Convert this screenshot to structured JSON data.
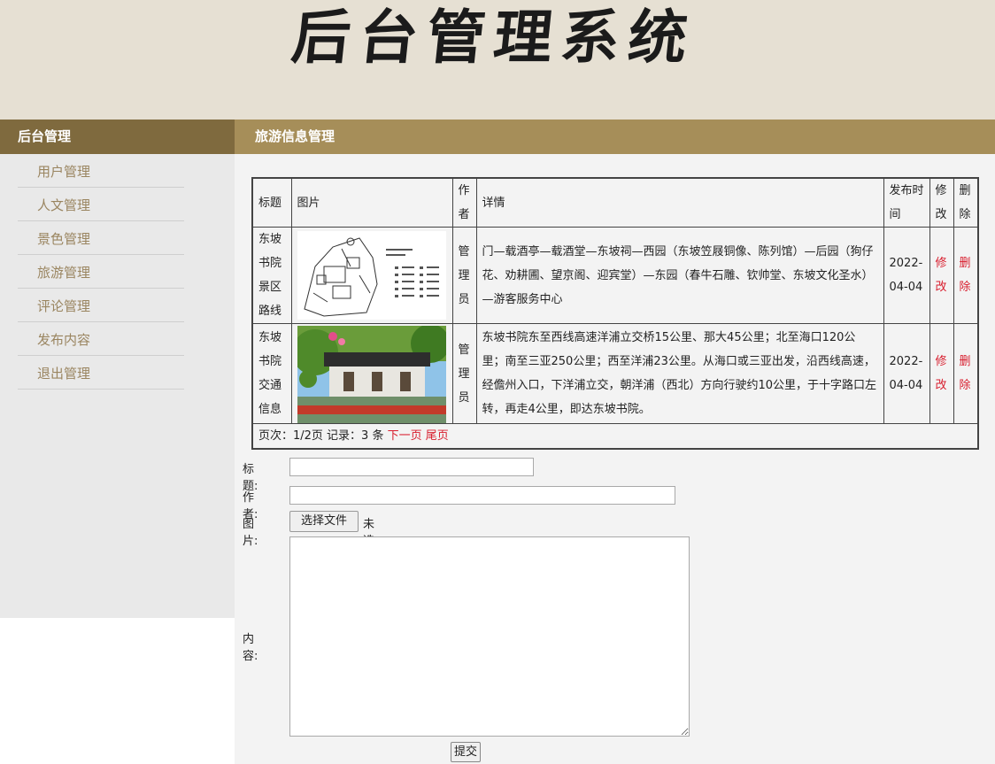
{
  "header": {
    "title": "后台管理系统"
  },
  "sidebar": {
    "heading": "后台管理",
    "items": [
      {
        "label": "用户管理"
      },
      {
        "label": "人文管理"
      },
      {
        "label": "景色管理"
      },
      {
        "label": "旅游管理"
      },
      {
        "label": "评论管理"
      },
      {
        "label": "发布内容"
      },
      {
        "label": "退出管理"
      }
    ]
  },
  "main": {
    "heading": "旅游信息管理"
  },
  "table": {
    "headers": [
      "标题",
      "图片",
      "作者",
      "详情",
      "发布时间",
      "修改",
      "删除"
    ],
    "rows": [
      {
        "title": "东坡书院景区路线",
        "image": "map-thumbnail",
        "author": "管理员",
        "details": "门—载酒亭—载酒堂—东坡祠—西园（东坡笠屐铜像、陈列馆）—后园（狗仔花、劝耕圃、望京阁、迎宾堂）—东园（春牛石雕、钦帅堂、东坡文化圣水）—游客服务中心",
        "date": "2022-04-04",
        "edit": "修改",
        "delete": "删除"
      },
      {
        "title": "东坡书院交通信息",
        "image": "garden-photo-thumbnail",
        "author": "管理员",
        "details": "东坡书院东至西线高速洋浦立交桥15公里、那大45公里；北至海口120公里；南至三亚250公里；西至洋浦23公里。从海口或三亚出发，沿西线高速，经儋州入口，下洋浦立交，朝洋浦（西北）方向行驶约10公里，于十字路口左转，再走4公里，即达东坡书院。",
        "date": "2022-04-04",
        "edit": "修改",
        "delete": "删除"
      }
    ],
    "pager": {
      "info": "页次：1/2页 记录：3 条",
      "next": "下一页",
      "last": "尾页"
    }
  },
  "form": {
    "title_label": "标题:",
    "title_value": "",
    "author_label": "作者:",
    "author_value": "",
    "image_label": "图片:",
    "file_button": "选择文件",
    "file_status": "未选择任何文件",
    "content_label": "内容:",
    "content_value": "",
    "submit_label": "提交"
  },
  "colors": {
    "banner_bg": "#e6e0d3",
    "sidebar_head": "#7f6a3e",
    "main_head": "#a68e59",
    "link_red": "#d81e2e",
    "sidebar_text": "#9a8560"
  }
}
